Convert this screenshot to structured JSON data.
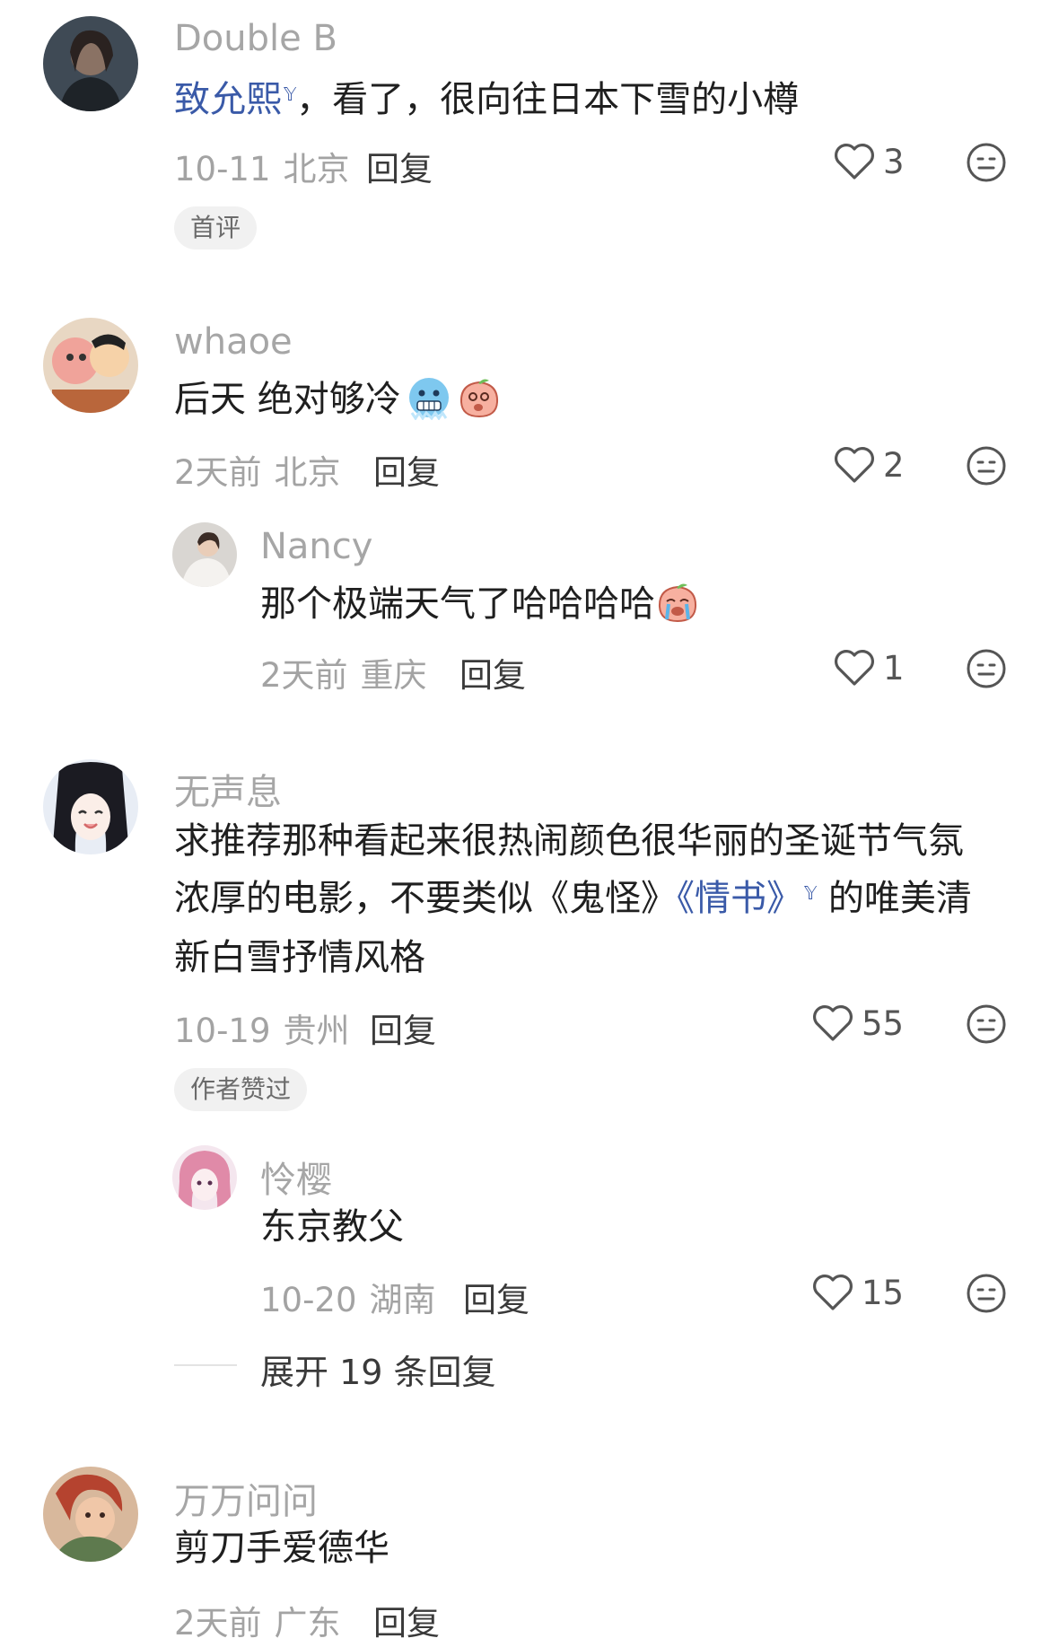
{
  "comments": [
    {
      "user": "Double B",
      "text_link": "致允熙",
      "text_rest": "，看了，很向往日本下雪的小樽",
      "date": "10-11",
      "location": "北京",
      "reply_label": "回复",
      "likes": "3",
      "badge": "首评"
    },
    {
      "user": "whaoe",
      "text": "后天 绝对够冷",
      "emojis": [
        "freezing-face-emoji",
        "peach-shy-emoji"
      ],
      "date": "2天前",
      "location": "北京",
      "reply_label": "回复",
      "likes": "2",
      "sub_reply": {
        "user": "Nancy",
        "text": "那个极端天气了哈哈哈哈",
        "emojis": [
          "peach-cry-emoji"
        ],
        "date": "2天前",
        "location": "重庆",
        "reply_label": "回复",
        "likes": "1"
      }
    },
    {
      "user": "无声息",
      "line1": "求推荐那种看起来很热闹颜色很华丽的圣诞节气氛",
      "line2_pre": "浓厚的电影，不要类似《鬼怪》",
      "line2_link": "《情书》",
      "line2_post": " 的唯美清",
      "line3": "新白雪抒情风格",
      "date": "10-19",
      "location": "贵州",
      "reply_label": "回复",
      "likes": "55",
      "badge": "作者赞过",
      "sub_reply": {
        "user": "怜樱",
        "text": "东京教父",
        "date": "10-20",
        "location": "湖南",
        "reply_label": "回复",
        "likes": "15"
      },
      "expand_label": "展开 19 条回复"
    },
    {
      "user": "万万问问",
      "text": "剪刀手爱德华",
      "date": "2天前",
      "location": "广东",
      "reply_label": "回复"
    }
  ],
  "colors": {
    "link": "#3a5aa8",
    "username": "#a6a6a6",
    "meta": "#a3a3a3",
    "badge_bg": "#f1f1f1"
  },
  "icons": [
    "heart-outline-icon",
    "dislike-face-icon",
    "search-mark-icon"
  ]
}
